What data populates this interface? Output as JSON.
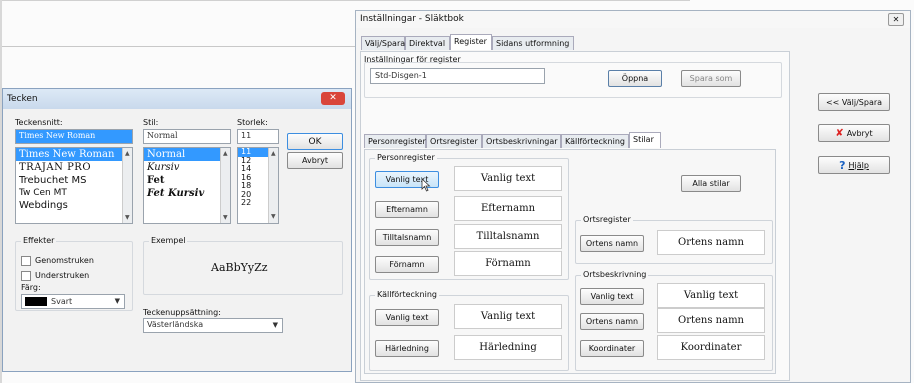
{
  "settings": {
    "title": "Inställningar - Släktbok",
    "top_tabs": [
      "Välj/Spara",
      "Direktval",
      "Register",
      "Sidans utformning"
    ],
    "group_title": "Inställningar för register",
    "register_value": "Std-Disgen-1",
    "open_label": "Öppna",
    "save_as_label": "Spara som",
    "sub_tabs": [
      "Personregister",
      "Ortsregister",
      "Ortsbeskrivningar",
      "Källförteckning",
      "Stilar"
    ],
    "person_group": "Personregister",
    "person_rows": [
      {
        "button": "Vanlig text",
        "sample": "Vanlig text"
      },
      {
        "button": "Efternamn",
        "sample": "Efternamn"
      },
      {
        "button": "Tilltalsnamn",
        "sample": "Tilltalsnamn"
      },
      {
        "button": "Förnamn",
        "sample": "Förnamn"
      }
    ],
    "source_group": "Källförteckning",
    "source_rows": [
      {
        "button": "Vanlig text",
        "sample": "Vanlig text"
      },
      {
        "button": "Härledning",
        "sample": "Härledning"
      }
    ],
    "all_styles_label": "Alla stilar",
    "place_group": "Ortsregister",
    "place_rows": [
      {
        "button": "Ortens namn",
        "sample": "Ortens namn"
      }
    ],
    "placedesc_group": "Ortsbeskrivning",
    "placedesc_rows": [
      {
        "button": "Vanlig text",
        "sample": "Vanlig text"
      },
      {
        "button": "Ortens namn",
        "sample": "Ortens namn"
      },
      {
        "button": "Koordinater",
        "sample": "Koordinater"
      }
    ],
    "side_buttons": {
      "back": "<< Välj/Spara",
      "cancel": "Avbryt",
      "help": "Hjälp"
    }
  },
  "font_dialog": {
    "title": "Tecken",
    "font_label": "Teckensnitt:",
    "font_value": "Times New Roman",
    "fonts": [
      "Times New Roman",
      "TRAJAN PRO",
      "Trebuchet MS",
      "Tw Cen MT",
      "Webdings"
    ],
    "style_label": "Stil:",
    "style_value": "Normal",
    "styles": [
      "Normal",
      "Kursiv",
      "Fet",
      "Fet Kursiv"
    ],
    "size_label": "Storlek:",
    "size_value": "11",
    "sizes": [
      "11",
      "12",
      "14",
      "16",
      "18",
      "20",
      "22"
    ],
    "ok_label": "OK",
    "cancel_label": "Avbryt",
    "effects_label": "Effekter",
    "strike_label": "Genomstruken",
    "underline_label": "Understruken",
    "color_label": "Färg:",
    "color_value": "Svart",
    "sample_label": "Exempel",
    "sample_text": "AaBbYyZz",
    "charset_label": "Teckenuppsättning:",
    "charset_value": "Västerländska"
  },
  "colors": {
    "selection": "#3399ff",
    "close": "#d9453a",
    "title_bar": "#d3e2f2"
  }
}
